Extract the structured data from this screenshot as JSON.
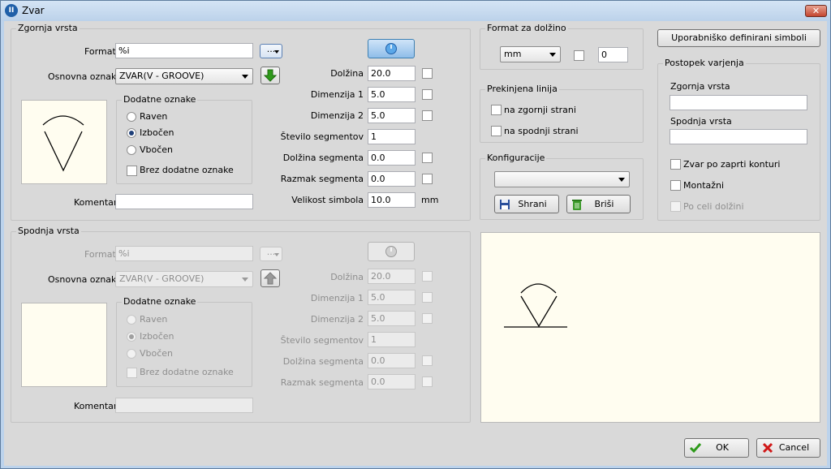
{
  "window": {
    "title": "Zvar",
    "app_icon_text": "II",
    "close_glyph": "✕"
  },
  "upper": {
    "title": "Zgornja vrsta",
    "format_label": "Format",
    "format_value": "%i",
    "dots_label": "...",
    "basic_label": "Osnovna oznaka",
    "basic_value": "ZVAR(V - GROOVE)",
    "extra_title": "Dodatne oznake",
    "radio_flat": "Raven",
    "radio_convex": "Izbočen",
    "radio_concave": "Vbočen",
    "no_extra": "Brez dodatne oznake",
    "comment_label": "Komentar",
    "comment_value": "",
    "length_label": "Dolžina",
    "length_value": "20.0",
    "dim1_label": "Dimenzija 1",
    "dim1_value": "5.0",
    "dim2_label": "Dimenzija 2",
    "dim2_value": "5.0",
    "segcount_label": "Število segmentov",
    "segcount_value": "1",
    "seglen_label": "Dolžina segmenta",
    "seglen_value": "0.0",
    "segspace_label": "Razmak segmenta",
    "segspace_value": "0.0",
    "symsize_label": "Velikost simbola",
    "symsize_value": "10.0",
    "symsize_unit": "mm"
  },
  "lower": {
    "title": "Spodnja vrsta",
    "format_label": "Format",
    "format_value": "%i",
    "dots_label": "...",
    "basic_label": "Osnovna oznaka",
    "basic_value": "ZVAR(V - GROOVE)",
    "extra_title": "Dodatne oznake",
    "radio_flat": "Raven",
    "radio_convex": "Izbočen",
    "radio_concave": "Vbočen",
    "no_extra": "Brez dodatne oznake",
    "comment_label": "Komentar",
    "comment_value": "",
    "length_label": "Dolžina",
    "length_value": "20.0",
    "dim1_label": "Dimenzija 1",
    "dim1_value": "5.0",
    "dim2_label": "Dimenzija 2",
    "dim2_value": "5.0",
    "segcount_label": "Število segmentov",
    "segcount_value": "1",
    "seglen_label": "Dolžina segmenta",
    "seglen_value": "0.0",
    "segspace_label": "Razmak segmenta",
    "segspace_value": "0.0"
  },
  "length_format": {
    "title": "Format za dolžino",
    "unit_value": "mm",
    "decimals_value": "0"
  },
  "broken_line": {
    "title": "Prekinjena linija",
    "upper_side": "na zgornji strani",
    "lower_side": "na spodnji strani"
  },
  "configurations": {
    "title": "Konfiguracije",
    "selected": "",
    "save_label": "Shrani",
    "delete_label": "Briši"
  },
  "user_symbols_label": "Uporabniško definirani simboli",
  "welding": {
    "title": "Postopek varjenja",
    "upper_label": "Zgornja vrsta",
    "upper_value": "",
    "lower_label": "Spodnja vrsta",
    "lower_value": "",
    "closed_contour": "Zvar po zaprti konturi",
    "assembly": "Montažni",
    "full_length": "Po celi dolžini"
  },
  "footer": {
    "ok_label": "OK",
    "cancel_label": "Cancel"
  },
  "colors": {
    "accent": "#1e5aa8",
    "green_arrow": "#2e9a1a",
    "preview_bg": "#fffdf0",
    "cancel_red": "#d01818"
  }
}
